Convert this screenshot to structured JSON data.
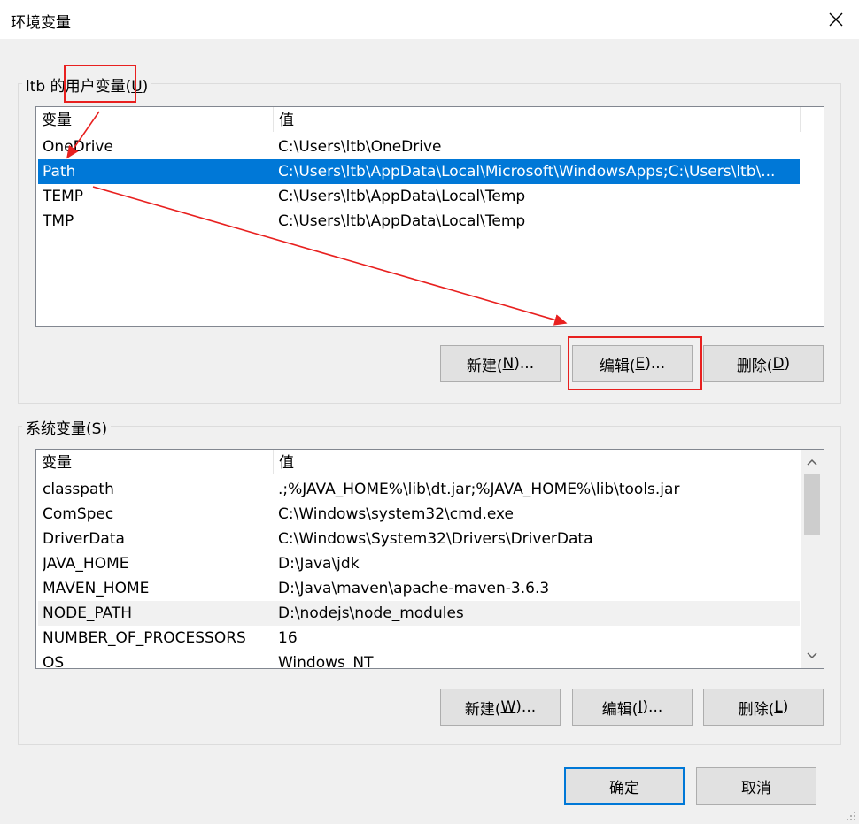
{
  "window": {
    "title": "环境变量",
    "close_icon": "close-icon"
  },
  "user_vars": {
    "group_label_prefix": "ltb 的用户变量(",
    "group_label_key": "U",
    "group_label_suffix": ")",
    "columns": [
      "变量",
      "值"
    ],
    "rows": [
      {
        "name": "OneDrive",
        "value": "C:\\Users\\ltb\\OneDrive"
      },
      {
        "name": "Path",
        "value": "C:\\Users\\ltb\\AppData\\Local\\Microsoft\\WindowsApps;C:\\Users\\ltb\\..."
      },
      {
        "name": "TEMP",
        "value": "C:\\Users\\ltb\\AppData\\Local\\Temp"
      },
      {
        "name": "TMP",
        "value": "C:\\Users\\ltb\\AppData\\Local\\Temp"
      }
    ],
    "selected_row": "Path",
    "buttons": {
      "new": {
        "prefix": "新建(",
        "key": "N",
        "suffix": ")..."
      },
      "edit": {
        "prefix": "编辑(",
        "key": "E",
        "suffix": ")..."
      },
      "delete": {
        "prefix": "删除(",
        "key": "D",
        "suffix": ")"
      }
    }
  },
  "system_vars": {
    "group_label_prefix": "系统变量(",
    "group_label_key": "S",
    "group_label_suffix": ")",
    "columns": [
      "变量",
      "值"
    ],
    "rows": [
      {
        "name": "classpath",
        "value": ".;%JAVA_HOME%\\lib\\dt.jar;%JAVA_HOME%\\lib\\tools.jar"
      },
      {
        "name": "ComSpec",
        "value": "C:\\Windows\\system32\\cmd.exe"
      },
      {
        "name": "DriverData",
        "value": "C:\\Windows\\System32\\Drivers\\DriverData"
      },
      {
        "name": "JAVA_HOME",
        "value": "D:\\Java\\jdk"
      },
      {
        "name": "MAVEN_HOME",
        "value": "D:\\Java\\maven\\apache-maven-3.6.3"
      },
      {
        "name": "NODE_PATH",
        "value": "D:\\nodejs\\node_modules"
      },
      {
        "name": "NUMBER_OF_PROCESSORS",
        "value": "16"
      },
      {
        "name": "OS",
        "value": "Windows_NT"
      }
    ],
    "hover_row": "NODE_PATH",
    "buttons": {
      "new": {
        "prefix": "新建(",
        "key": "W",
        "suffix": ")..."
      },
      "edit": {
        "prefix": "编辑(",
        "key": "I",
        "suffix": ")..."
      },
      "delete": {
        "prefix": "删除(",
        "key": "L",
        "suffix": ")"
      }
    }
  },
  "footer": {
    "ok": "确定",
    "cancel": "取消"
  },
  "colors": {
    "selection": "#0078d7",
    "annotation": "#e8201f"
  }
}
